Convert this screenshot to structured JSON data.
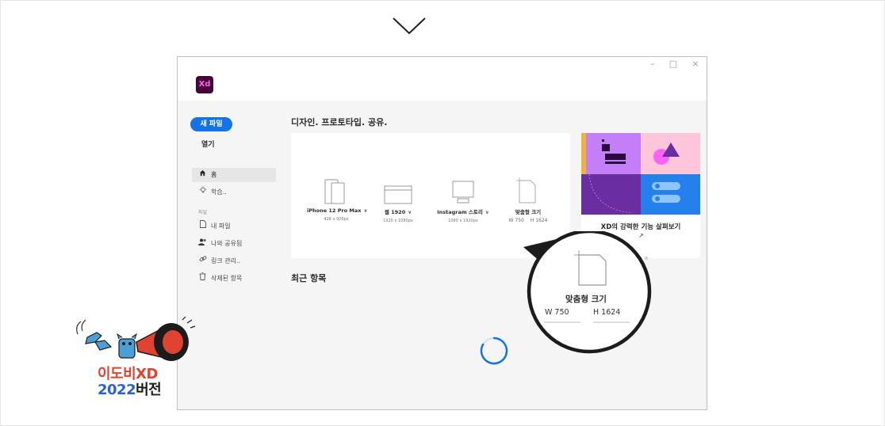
{
  "app": {
    "logo_text": "Xd",
    "window_controls": {
      "minimize": "–",
      "maximize": "□",
      "close": "×"
    }
  },
  "sidebar": {
    "new_file_label": "새 파일",
    "open_label": "열기",
    "items": [
      {
        "icon": "home-icon",
        "label": "홈",
        "active": true
      },
      {
        "icon": "lightbulb-icon",
        "label": "학습.."
      }
    ],
    "files_section_label": "파일",
    "file_items": [
      {
        "icon": "document-icon",
        "label": "내 파일"
      },
      {
        "icon": "people-icon",
        "label": "나와 공유됨"
      },
      {
        "icon": "link-icon",
        "label": "링크 관리.."
      },
      {
        "icon": "trash-icon",
        "label": "삭제된 항목"
      }
    ]
  },
  "main": {
    "hero_title": "디자인. 프로토타입. 공유.",
    "presets": [
      {
        "icon": "phone-icon",
        "name": "iPhone 12 Pro Max",
        "dims": "428 x 926px"
      },
      {
        "icon": "web-icon",
        "name": "웹 1920",
        "dims": "1920 x 1080px"
      },
      {
        "icon": "instagram-icon",
        "name": "Instagram 스토리",
        "dims": "1080 x 1920px"
      },
      {
        "icon": "custom-size-icon",
        "name": "맞춤형 크기",
        "width": "W 750",
        "height": "H 1624"
      }
    ],
    "feature": {
      "title": "XD의 강력한 기능 살펴보기",
      "link_glyph": "↗"
    },
    "recent_title": "최근 항목"
  },
  "callout": {
    "title": "맞춤형 크기",
    "width": "W 750",
    "height": "H 1624"
  },
  "badge": {
    "line1": "이도비XD",
    "line2_number": "2022",
    "line2_suffix": "버전"
  },
  "colors": {
    "accent": "#1473e6",
    "xd_bg": "#470137",
    "xd_fg": "#ff61f6",
    "badge_red": "#e0432f",
    "badge_blue": "#2a64c6"
  }
}
